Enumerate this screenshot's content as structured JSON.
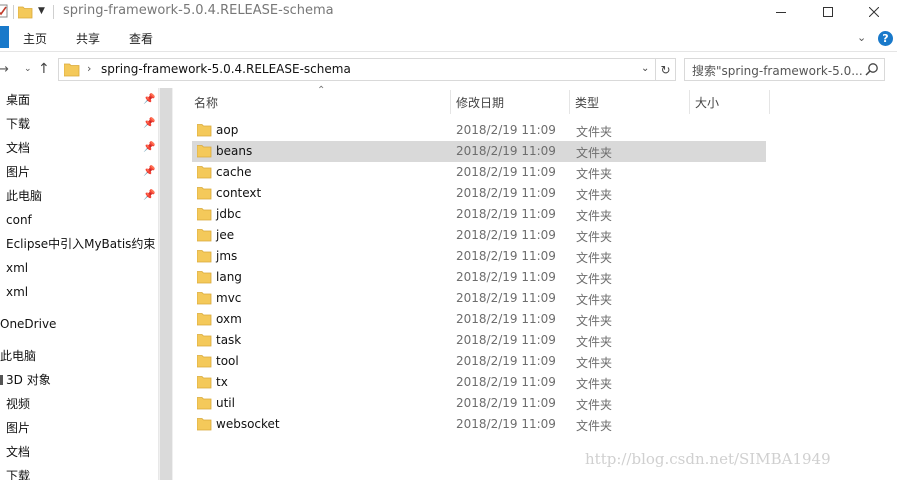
{
  "window": {
    "title": "spring-framework-5.0.4.RELEASE-schema"
  },
  "ribbon": {
    "tabs": [
      {
        "label": "主页"
      },
      {
        "label": "共享"
      },
      {
        "label": "查看"
      }
    ],
    "help_label": "?"
  },
  "address": {
    "path": "spring-framework-5.0.4.RELEASE-schema",
    "search_placeholder": "搜索\"spring-framework-5.0..."
  },
  "nav": {
    "items": [
      {
        "label": "桌面",
        "pinned": true
      },
      {
        "label": "下载",
        "pinned": true
      },
      {
        "label": "文档",
        "pinned": true
      },
      {
        "label": "图片",
        "pinned": true
      },
      {
        "label": "此电脑",
        "pinned": true
      },
      {
        "label": "conf",
        "pinned": false
      },
      {
        "label": "Eclipse中引入MyBatis约束",
        "pinned": false
      },
      {
        "label": "xml",
        "pinned": false
      },
      {
        "label": "xml",
        "pinned": false
      },
      {
        "label": "OneDrive",
        "pinned": false
      },
      {
        "label": "此电脑",
        "pinned": false
      },
      {
        "label": "3D 对象",
        "pinned": false
      },
      {
        "label": "视频",
        "pinned": false
      },
      {
        "label": "图片",
        "pinned": false
      },
      {
        "label": "文档",
        "pinned": false
      },
      {
        "label": "下载",
        "pinned": false
      }
    ]
  },
  "columns": {
    "name": "名称",
    "date": "修改日期",
    "type": "类型",
    "size": "大小"
  },
  "files": [
    {
      "name": "aop",
      "date": "2018/2/19 11:09",
      "type": "文件夹"
    },
    {
      "name": "beans",
      "date": "2018/2/19 11:09",
      "type": "文件夹",
      "selected": true
    },
    {
      "name": "cache",
      "date": "2018/2/19 11:09",
      "type": "文件夹"
    },
    {
      "name": "context",
      "date": "2018/2/19 11:09",
      "type": "文件夹"
    },
    {
      "name": "jdbc",
      "date": "2018/2/19 11:09",
      "type": "文件夹"
    },
    {
      "name": "jee",
      "date": "2018/2/19 11:09",
      "type": "文件夹"
    },
    {
      "name": "jms",
      "date": "2018/2/19 11:09",
      "type": "文件夹"
    },
    {
      "name": "lang",
      "date": "2018/2/19 11:09",
      "type": "文件夹"
    },
    {
      "name": "mvc",
      "date": "2018/2/19 11:09",
      "type": "文件夹"
    },
    {
      "name": "oxm",
      "date": "2018/2/19 11:09",
      "type": "文件夹"
    },
    {
      "name": "task",
      "date": "2018/2/19 11:09",
      "type": "文件夹"
    },
    {
      "name": "tool",
      "date": "2018/2/19 11:09",
      "type": "文件夹"
    },
    {
      "name": "tx",
      "date": "2018/2/19 11:09",
      "type": "文件夹"
    },
    {
      "name": "util",
      "date": "2018/2/19 11:09",
      "type": "文件夹"
    },
    {
      "name": "websocket",
      "date": "2018/2/19 11:09",
      "type": "文件夹"
    }
  ],
  "watermark": "http://blog.csdn.net/SIMBA1949",
  "colors": {
    "accent": "#1979ca",
    "selection": "#d9d9d9",
    "folder": "#f4c95a"
  }
}
